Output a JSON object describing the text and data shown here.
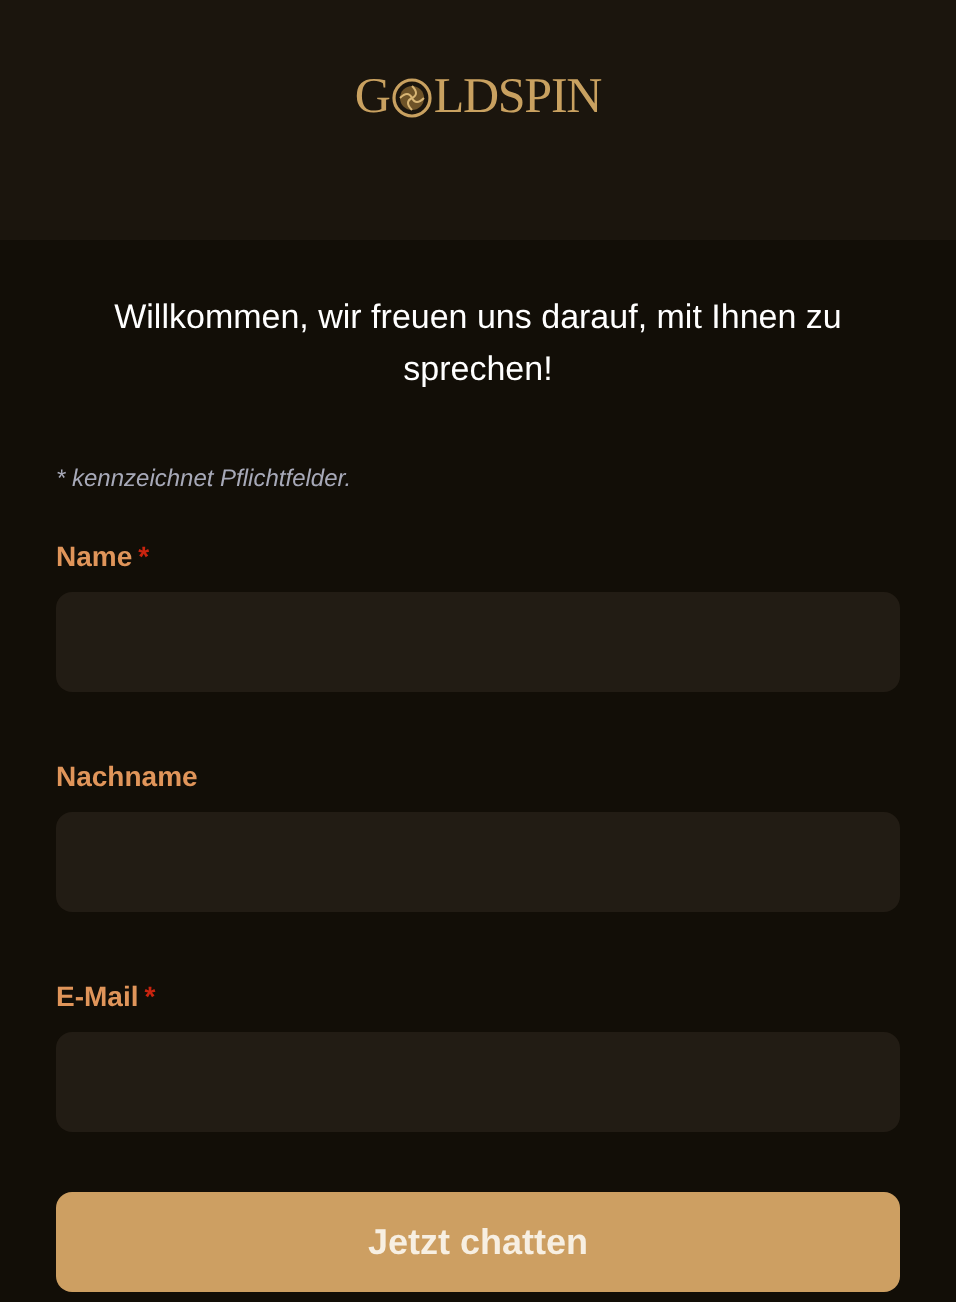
{
  "logo": {
    "start": "G",
    "end": "LDSPIN"
  },
  "welcome": "Willkommen, wir freuen uns darauf, mit Ihnen zu sprechen!",
  "required_note": "* kennzeichnet Pflichtfelder.",
  "fields": [
    {
      "label": "Name",
      "required_marker": "*"
    },
    {
      "label": "Nachname"
    },
    {
      "label": "E-Mail",
      "required_marker": "*"
    }
  ],
  "submit": "Jetzt chatten"
}
